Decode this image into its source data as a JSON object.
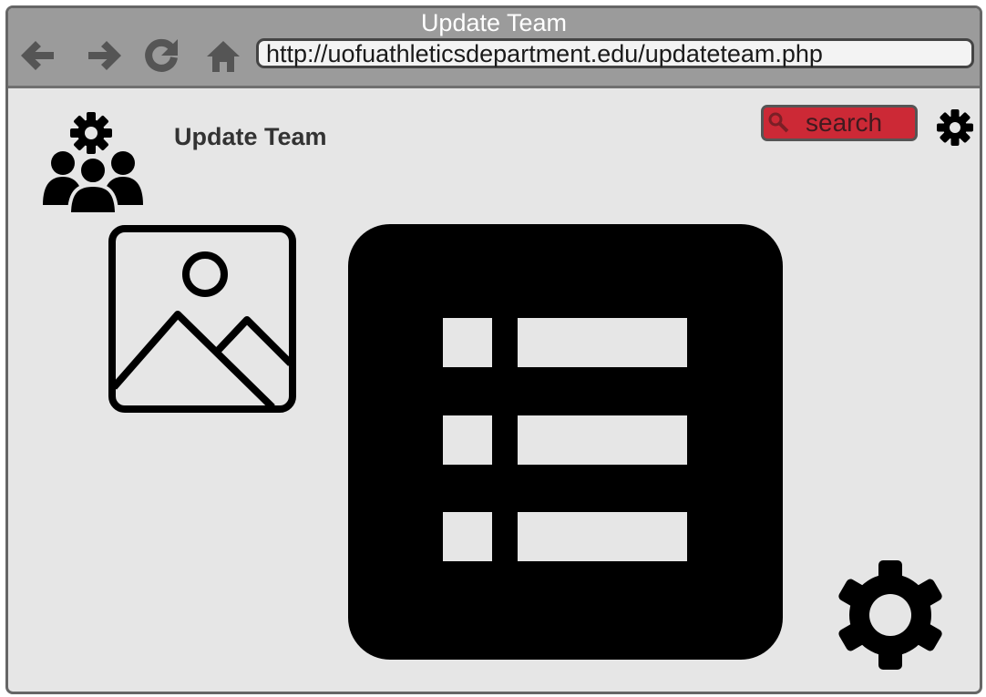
{
  "window": {
    "title": "Update Team",
    "url": "http://uofuathleticsdepartment.edu/updateteam.php"
  },
  "toolbar": {
    "icons": [
      "back-arrow-icon",
      "forward-arrow-icon",
      "reload-icon",
      "home-icon"
    ]
  },
  "header": {
    "page_title": "Update Team",
    "search_placeholder": "search",
    "icons": [
      "team-management-icon",
      "search-icon",
      "settings-icon"
    ]
  },
  "content": {
    "icons": [
      "image-placeholder-icon",
      "list-icon",
      "large-gear-icon"
    ],
    "list_rows": 3
  },
  "colors": {
    "titlebar": "#9b9b9b",
    "background": "#e6e6e6",
    "search_accent": "#cc2936",
    "icon": "#000000"
  }
}
